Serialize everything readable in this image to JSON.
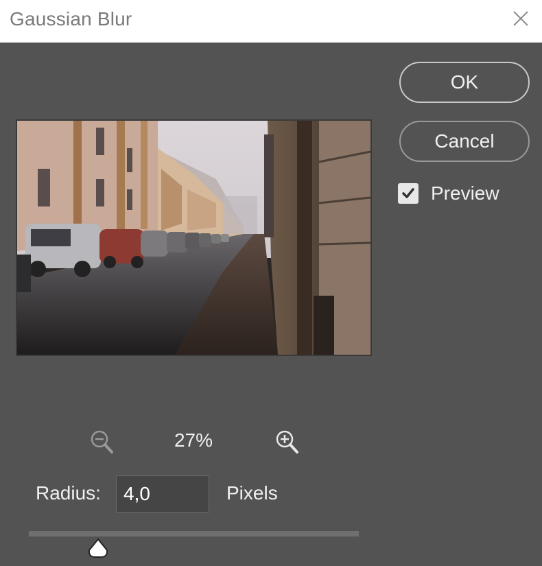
{
  "window": {
    "title": "Gaussian Blur",
    "close_icon": "close-icon"
  },
  "buttons": {
    "ok_label": "OK",
    "cancel_label": "Cancel"
  },
  "preview_toggle": {
    "label": "Preview",
    "checked": true
  },
  "zoom": {
    "level": "27%",
    "zoom_out_icon": "zoom-out-icon",
    "zoom_in_icon": "zoom-in-icon"
  },
  "radius": {
    "label": "Radius:",
    "value": "4,0",
    "units": "Pixels",
    "slider_fraction": 0.21
  },
  "colors": {
    "dialog_bg": "#535353",
    "titlebar_bg": "#ffffff",
    "text": "#f0f0f0"
  }
}
